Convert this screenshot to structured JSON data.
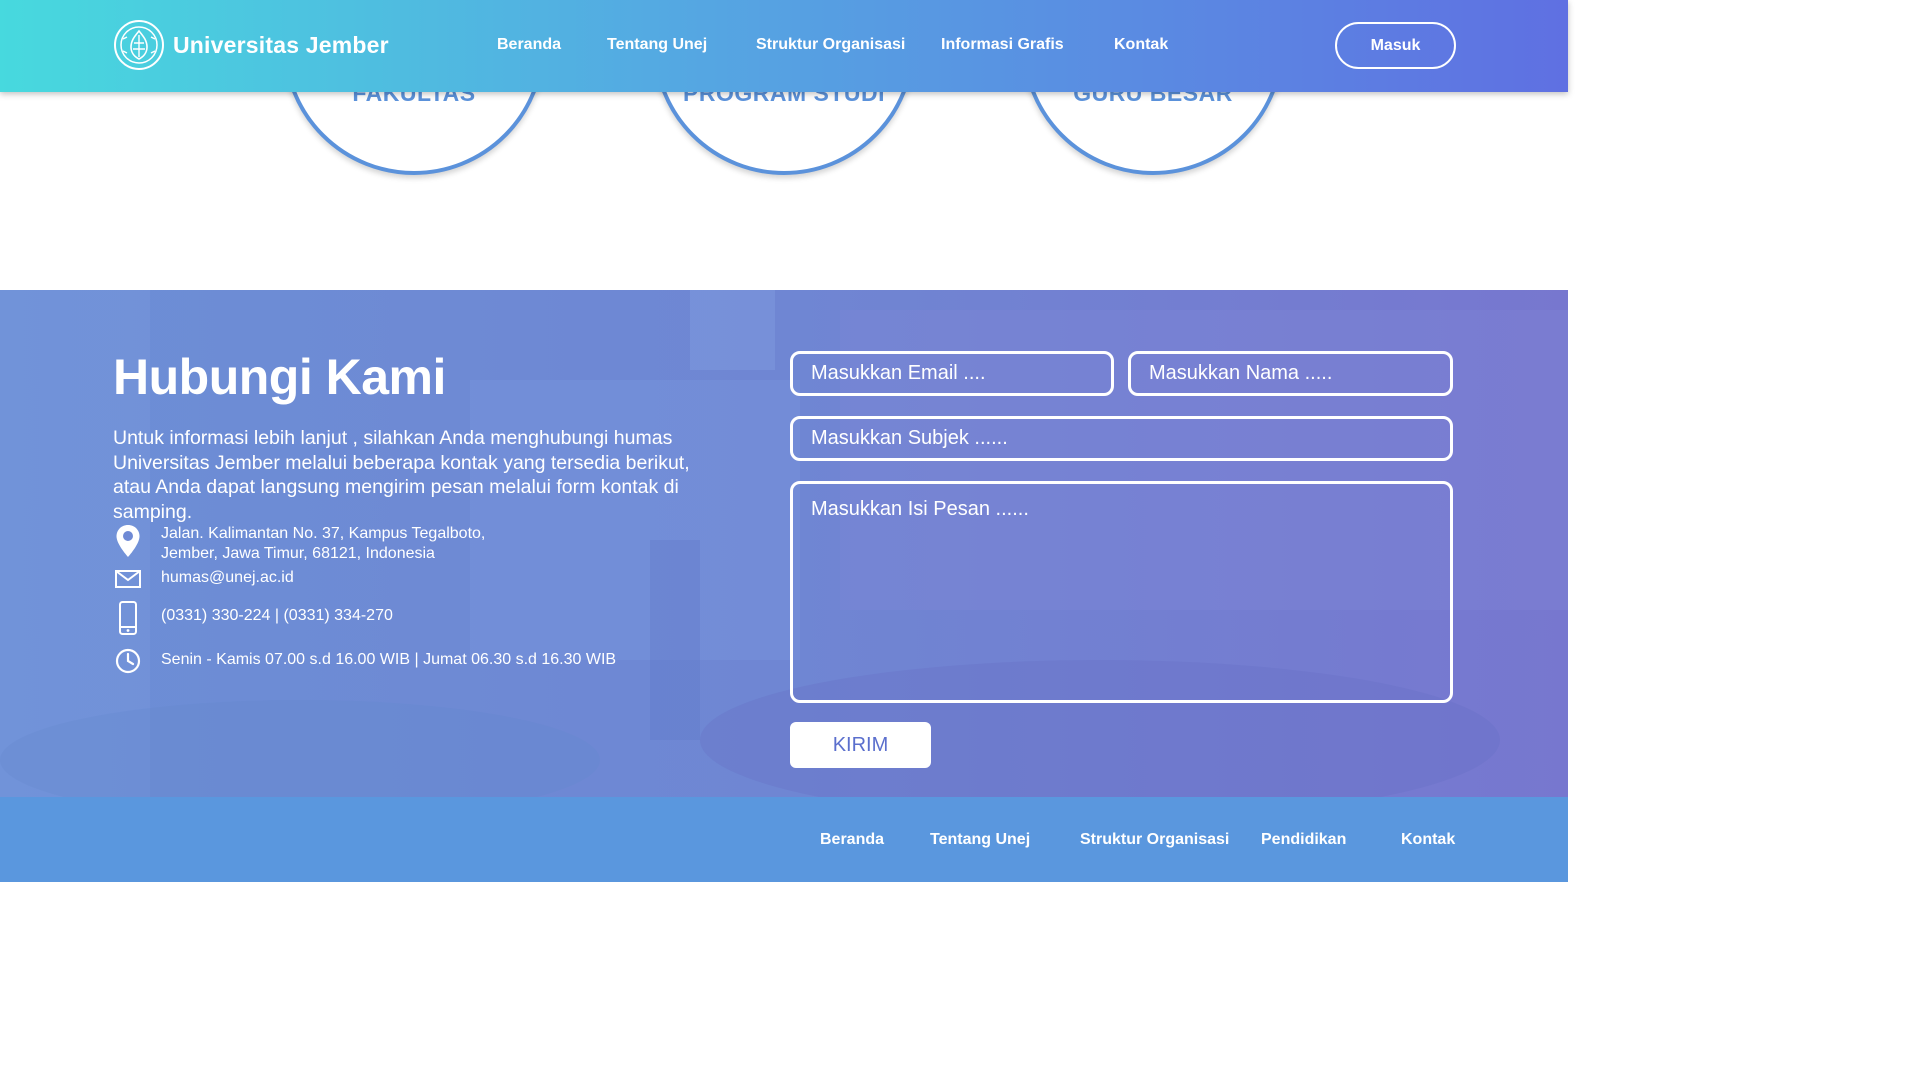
{
  "header": {
    "brand_name": "Universitas Jember",
    "nav": [
      "Beranda",
      "Tentang Unej",
      "Struktur Organisasi",
      "Informasi Grafis",
      "Kontak"
    ],
    "login_label": "Masuk"
  },
  "stats": [
    "FAKULTAS",
    "PROGRAM STUDI",
    "GURU BESAR"
  ],
  "contact": {
    "title": "Hubungi Kami",
    "description": "Untuk informasi lebih lanjut , silahkan Anda menghubungi humas Universitas Jember melalui beberapa kontak yang tersedia berikut, atau Anda dapat langsung mengirim pesan melalui form kontak di samping.",
    "address_line1": "Jalan. Kalimantan No. 37, Kampus Tegalboto,",
    "address_line2": "Jember, Jawa Timur, 68121, Indonesia",
    "email": "humas@unej.ac.id",
    "phone": "(0331) 330-224 | (0331) 334-270",
    "hours": "Senin - Kamis 07.00 s.d 16.00 WIB | Jumat 06.30 s.d 16.30 WIB",
    "form": {
      "email_placeholder": "Masukkan Email ....",
      "name_placeholder": "Masukkan Nama .....",
      "subject_placeholder": "Masukkan Subjek ......",
      "message_placeholder": "Masukkan Isi Pesan ......",
      "submit_label": "KIRIM"
    }
  },
  "footer": {
    "nav": [
      "Beranda",
      "Tentang Unej",
      "Struktur Organisasi",
      "Pendidikan",
      "Kontak"
    ]
  },
  "colors": {
    "header_start": "#47d9de",
    "header_end": "#5f70e2",
    "accent_blue": "#5b92db",
    "footer_bg": "#5a97de",
    "contact_bg": "#6f86d3"
  },
  "icons": {
    "logo": "university-seal",
    "address": "location-pin-icon",
    "email": "mail-icon",
    "phone": "mobile-phone-icon",
    "hours": "clock-icon"
  }
}
